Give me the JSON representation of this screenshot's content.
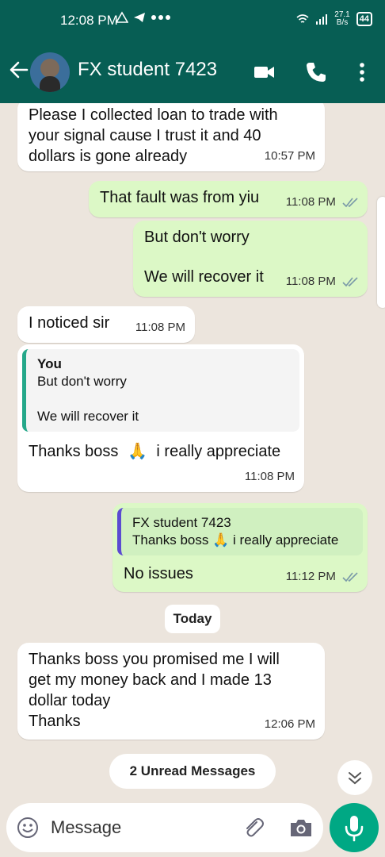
{
  "status_bar": {
    "time": "12:08 PM",
    "net_speed_value": "27.1",
    "net_speed_unit": "B/s",
    "battery": "44"
  },
  "header": {
    "contact_name": "FX student 7423"
  },
  "messages": [
    {
      "text": "Please I collected loan to trade with your signal cause I trust it and 40 dollars is gone already",
      "time": "10:57 PM"
    },
    {
      "text": "That fault was from yiu",
      "time": "11:08 PM"
    },
    {
      "text1": "But don't worry",
      "text2": "We will recover it",
      "time": "11:08 PM"
    },
    {
      "text": "I noticed sir",
      "time": "11:08 PM"
    },
    {
      "quote_author": "You",
      "quote_text1": "But don't worry",
      "quote_text2": "We will recover it",
      "text_a": "Thanks boss",
      "emoji": "🙏",
      "text_b": "i really appreciate",
      "time": "11:08 PM"
    },
    {
      "quote_author": "FX student 7423",
      "quote_text_a": "Thanks boss",
      "quote_emoji": "🙏",
      "quote_text_b": "i really appreciate",
      "text": "No issues",
      "time": "11:12 PM"
    },
    {
      "text_lines": [
        "Thanks boss you promised me I will",
        "get my money back and I made 13",
        "dollar today",
        "Thanks"
      ],
      "time": "12:06 PM"
    }
  ],
  "date_divider": "Today",
  "unread_banner": "2 Unread Messages",
  "composer": {
    "placeholder": "Message"
  },
  "colors": {
    "header": "#075e54",
    "outgoing": "#dcf8c6",
    "incoming": "#ffffff",
    "accent": "#00a884"
  },
  "icons": [
    "back-arrow-icon",
    "video-call-icon",
    "phone-icon",
    "more-options-icon",
    "emoji-icon",
    "attach-icon",
    "camera-icon",
    "mic-icon",
    "double-chevron-down-icon",
    "read-ticks-icon"
  ]
}
